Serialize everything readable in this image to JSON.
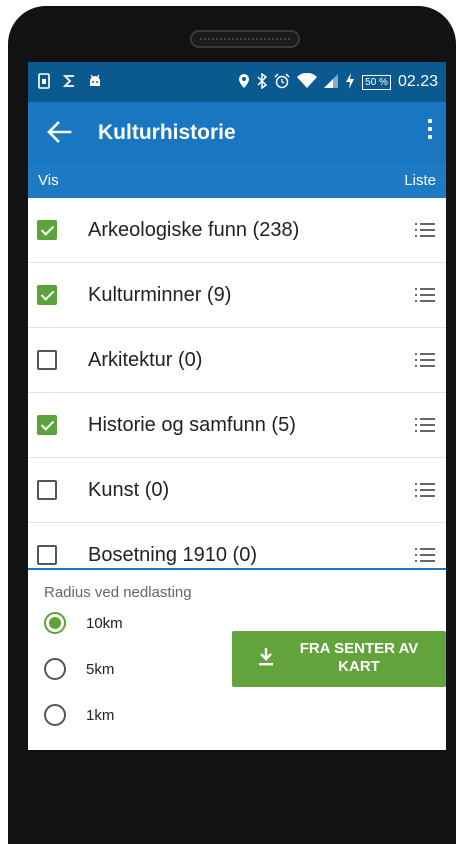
{
  "status_bar": {
    "left_icons": [
      "sim-icon",
      "s-icon",
      "android-icon"
    ],
    "right_icons": [
      "location-icon",
      "bluetooth-icon",
      "alarm-icon",
      "wifi-icon",
      "signal-icon",
      "charging-icon"
    ],
    "battery": "50 %",
    "time": "02.23"
  },
  "app_bar": {
    "title": "Kulturhistorie"
  },
  "list_header": {
    "left": "Vis",
    "right": "Liste"
  },
  "layers": [
    {
      "label": "Arkeologiske funn (238)",
      "checked": true
    },
    {
      "label": "Kulturminner (9)",
      "checked": true
    },
    {
      "label": "Arkitektur (0)",
      "checked": false
    },
    {
      "label": "Historie og samfunn (5)",
      "checked": true
    },
    {
      "label": "Kunst (0)",
      "checked": false
    },
    {
      "label": "Bosetning 1910 (0)",
      "checked": false
    }
  ],
  "download": {
    "radius_label": "Radius ved nedlasting",
    "options": [
      {
        "label": "10km",
        "selected": true
      },
      {
        "label": "5km",
        "selected": false
      },
      {
        "label": "1km",
        "selected": false
      }
    ],
    "button_label": "FRA SENTER AV KART"
  },
  "colors": {
    "status_bar": "#0a5a8f",
    "app_bar": "#1976c1",
    "accent_green": "#5ca43a"
  }
}
